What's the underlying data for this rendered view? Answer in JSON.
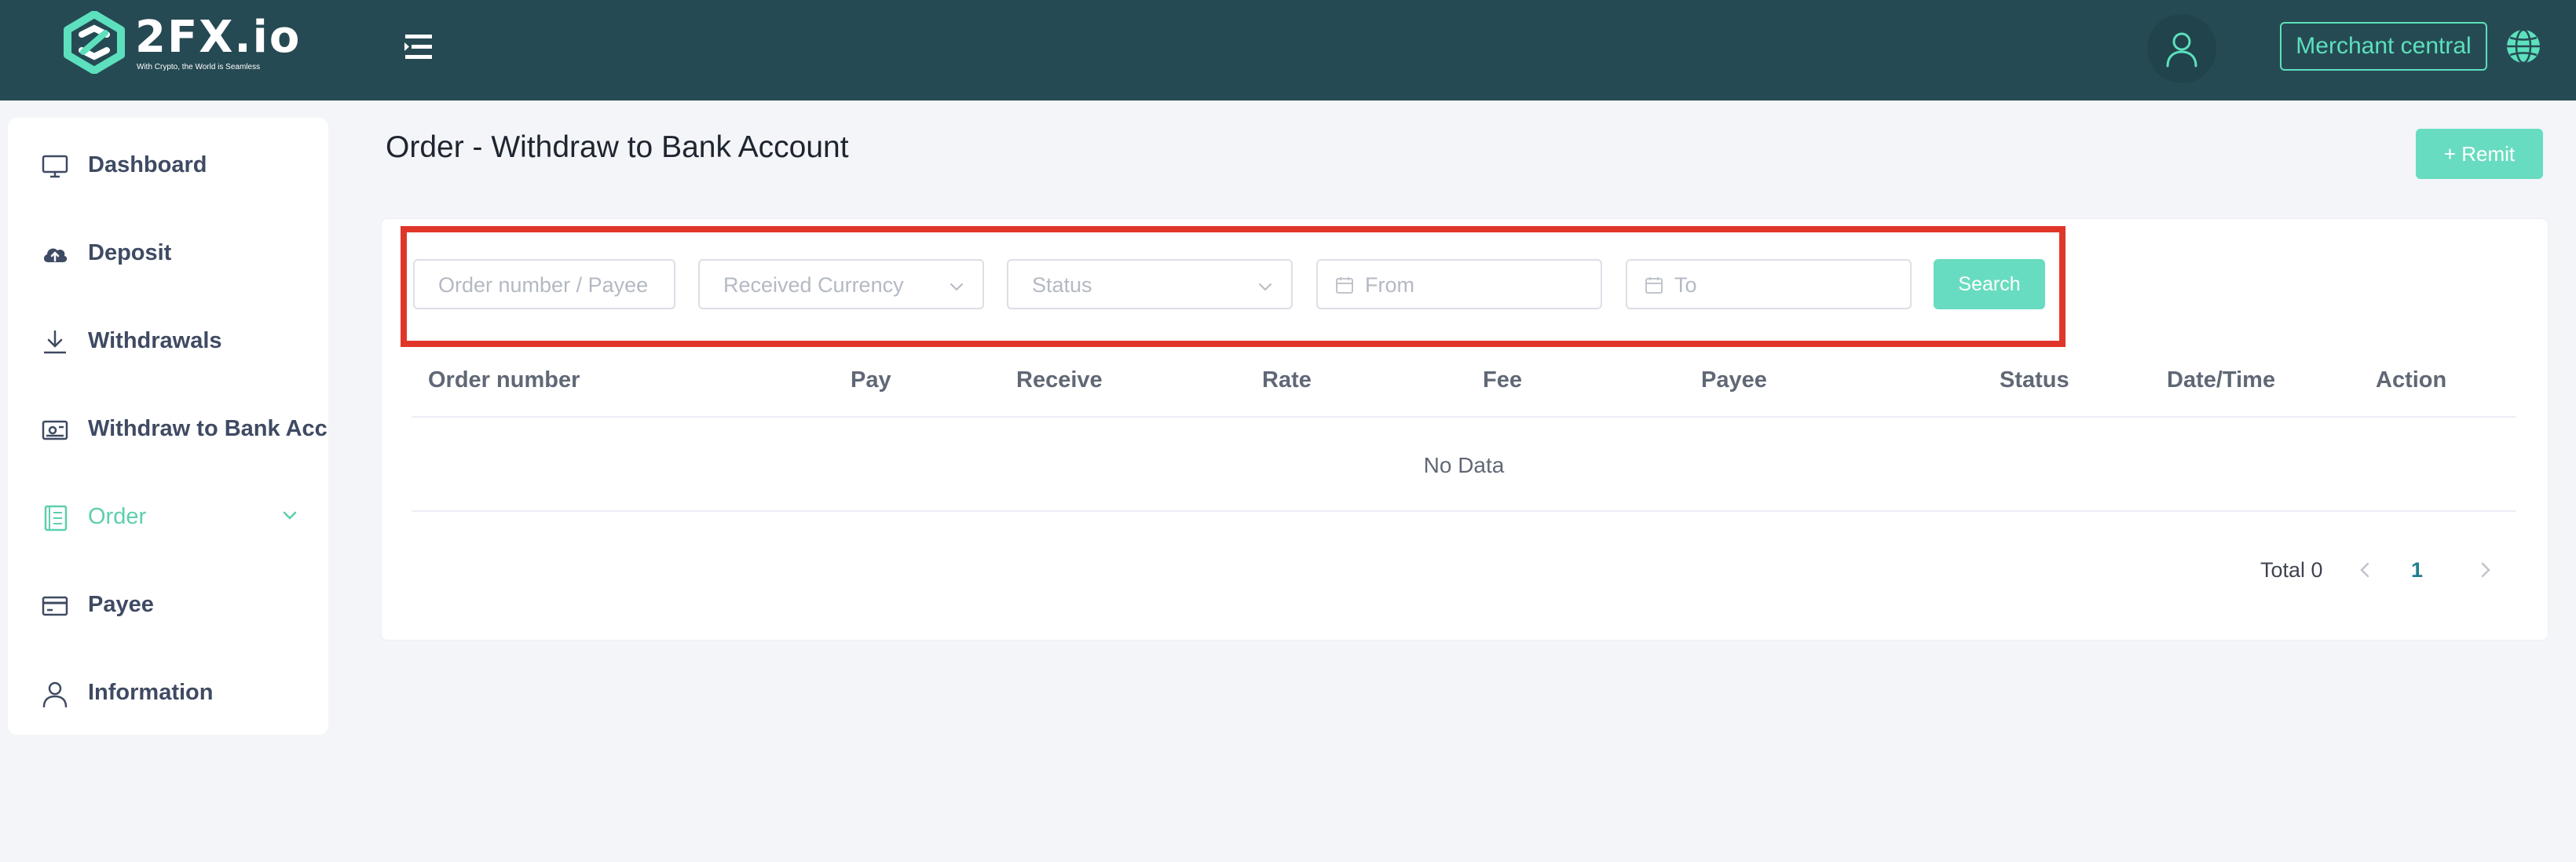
{
  "header": {
    "logo_text": "2FX.io",
    "logo_tagline": "With Crypto, the World is Seamless",
    "merchant_button": "Merchant central",
    "colors": {
      "bar": "#264a53",
      "accent": "#5ce0bd"
    }
  },
  "sidebar": {
    "items": [
      {
        "label": "Dashboard",
        "icon": "monitor-icon"
      },
      {
        "label": "Deposit",
        "icon": "cloud-upload-icon"
      },
      {
        "label": "Withdrawals",
        "icon": "download-icon"
      },
      {
        "label": "Withdraw to Bank Account",
        "icon": "bank-card-icon"
      },
      {
        "label": "Order",
        "icon": "document-list-icon",
        "active": true,
        "expanded": true
      },
      {
        "label": "Payee",
        "icon": "credit-card-icon"
      },
      {
        "label": "Information",
        "icon": "user-icon"
      }
    ]
  },
  "page": {
    "title": "Order - Withdraw to Bank Account",
    "remit_button": "+ Remit"
  },
  "filters": {
    "order_placeholder": "Order number / Payee",
    "currency_placeholder": "Received Currency",
    "status_placeholder": "Status",
    "from_placeholder": "From",
    "to_placeholder": "To",
    "search_button": "Search"
  },
  "table": {
    "columns": [
      "Order number",
      "Pay",
      "Receive",
      "Rate",
      "Fee",
      "Payee",
      "Status",
      "Date/Time",
      "Action"
    ],
    "rows": [],
    "empty_text": "No Data"
  },
  "pagination": {
    "total_label": "Total 0",
    "current_page": "1"
  }
}
